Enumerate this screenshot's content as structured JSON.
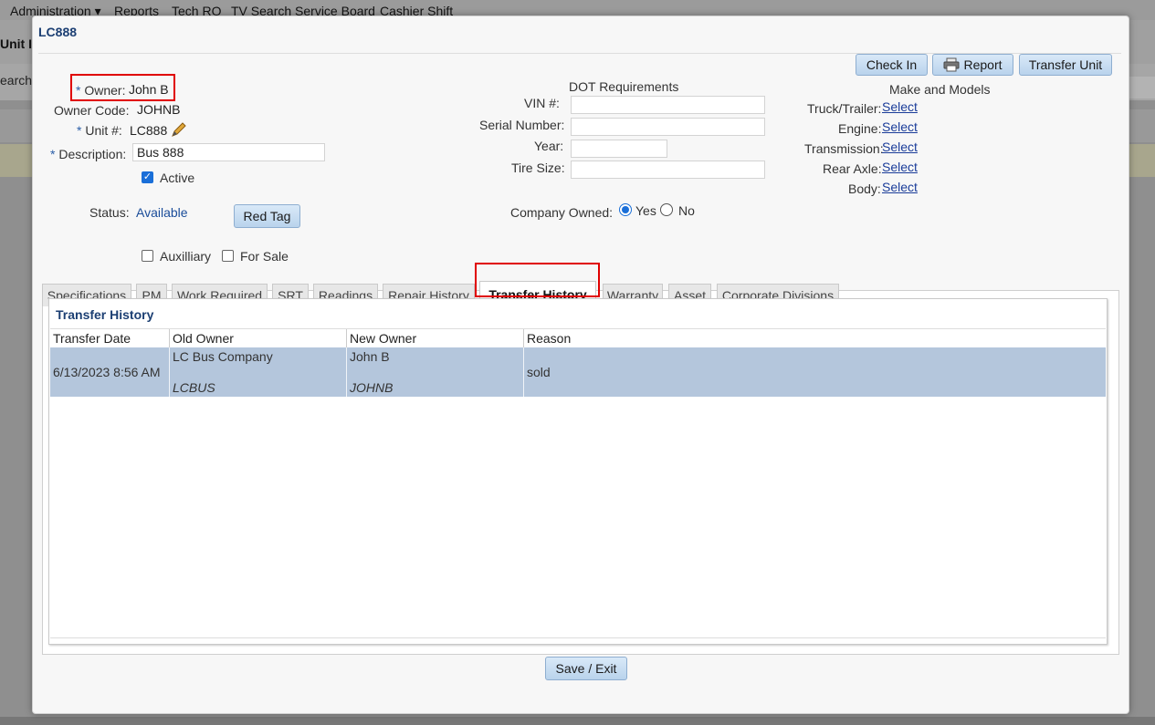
{
  "background": {
    "nav": [
      "Administration ▾",
      "Reports",
      "Tech RO",
      "TV Search Service Board",
      "Cashier Shift"
    ],
    "unit_label": "Unit I",
    "search_label": "earch"
  },
  "modal": {
    "title": "LC888",
    "buttons": {
      "check_in": "Check In",
      "report": "Report",
      "transfer_unit": "Transfer Unit",
      "red_tag": "Red Tag",
      "save_exit": "Save / Exit"
    },
    "owner": {
      "label": "Owner:",
      "value": "John B"
    },
    "owner_code": {
      "label": "Owner Code:",
      "value": "JOHNB"
    },
    "unit_no": {
      "label": "Unit #:",
      "value": "LC888"
    },
    "description": {
      "label": "Description:",
      "value": "Bus 888"
    },
    "active": {
      "label": "Active",
      "checked": true
    },
    "status": {
      "label": "Status:",
      "value": "Available"
    },
    "auxiliary": {
      "label": "Auxilliary",
      "checked": false
    },
    "for_sale": {
      "label": "For Sale",
      "checked": false
    },
    "dot": {
      "heading": "DOT Requirements",
      "vin_label": "VIN #:",
      "vin_value": "",
      "serial_label": "Serial Number:",
      "serial_value": "",
      "year_label": "Year:",
      "year_value": "",
      "tire_label": "Tire Size:",
      "tire_value": ""
    },
    "company_owned": {
      "label": "Company Owned:",
      "yes": "Yes",
      "no": "No",
      "selected": "Yes"
    },
    "make_models": {
      "heading": "Make and Models",
      "rows": [
        {
          "label": "Truck/Trailer:",
          "link": "Select"
        },
        {
          "label": "Engine:",
          "link": "Select"
        },
        {
          "label": "Transmission:",
          "link": "Select"
        },
        {
          "label": "Rear Axle:",
          "link": "Select"
        },
        {
          "label": "Body:",
          "link": "Select"
        }
      ]
    },
    "tabs": [
      "Specifications",
      "PM",
      "Work Required",
      "SRT",
      "Readings",
      "Repair History",
      "Transfer History",
      "Warranty",
      "Asset",
      "Corporate Divisions"
    ],
    "active_tab": "Transfer History",
    "transfer_history": {
      "title": "Transfer History",
      "columns": [
        "Transfer Date",
        "Old Owner",
        "New Owner",
        "Reason"
      ],
      "rows": [
        {
          "date": "6/13/2023 8:56 AM",
          "old_owner": "LC Bus Company",
          "old_code": "LCBUS",
          "new_owner": "John B",
          "new_code": "JOHNB",
          "reason": "sold"
        }
      ]
    }
  },
  "colors": {
    "accent": "#1c3f73",
    "highlight_box": "#e00000",
    "row_selected": "#b4c6dc"
  }
}
